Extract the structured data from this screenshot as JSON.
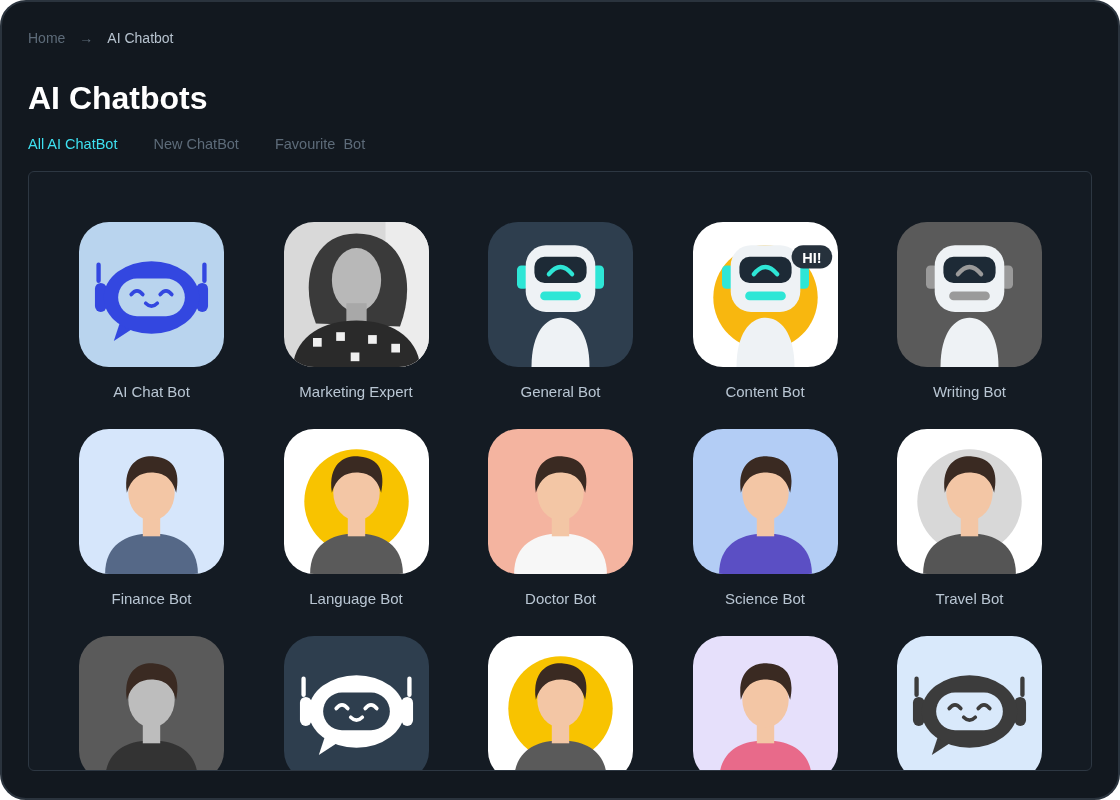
{
  "breadcrumb": {
    "items": [
      {
        "label": "Home"
      },
      {
        "label": "AI Chatbot"
      }
    ],
    "separator": "→"
  },
  "title": "AI Chatbots",
  "tabs": [
    {
      "label": "All AI ChatBot",
      "selected": true
    },
    {
      "label": "New ChatBot",
      "selected": false
    },
    {
      "label": "Favourite  Bot",
      "selected": false
    }
  ],
  "bots": [
    {
      "name": "AI Chat Bot",
      "kind": "bubble-robot",
      "color": "#b9d4ee"
    },
    {
      "name": "Marketing Expert",
      "kind": "picture"
    },
    {
      "name": "General Bot",
      "kind": "robot",
      "color": "#2e3e4e"
    },
    {
      "name": "Content Bot",
      "kind": "robot",
      "color": "#ffffff",
      "badge": "HI!"
    },
    {
      "name": "Writing Bot",
      "kind": "robot",
      "color": "#5a5a5a"
    },
    {
      "name": "Finance Bot",
      "kind": "person",
      "color": "#d6e6fb"
    },
    {
      "name": "Language Bot",
      "kind": "person",
      "color": "#ffffff"
    },
    {
      "name": "Doctor Bot",
      "kind": "person",
      "color": "#f4b4a0"
    },
    {
      "name": "Science Bot",
      "kind": "person",
      "color": "#b3cdf5"
    },
    {
      "name": "Travel Bot",
      "kind": "person",
      "color": "#ffffff"
    },
    {
      "kind": "person",
      "color": "#5a5a5a"
    },
    {
      "kind": "bubble-robot",
      "color": "#2e3e4e"
    },
    {
      "kind": "person",
      "color": "#ffffff"
    },
    {
      "kind": "person",
      "color": "#e6e0fb"
    },
    {
      "kind": "bubble-robot",
      "color": "#d9e9fb"
    }
  ]
}
